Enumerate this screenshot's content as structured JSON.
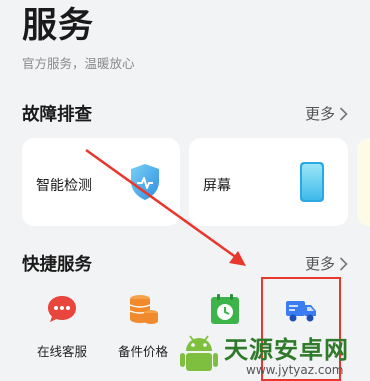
{
  "header": {
    "title": "服务",
    "subtitle": "官方服务，温暖放心"
  },
  "troubleshooting": {
    "title": "故障排查",
    "more_label": "更多",
    "cards": [
      {
        "label": "智能检测",
        "icon": "shield-check-icon"
      },
      {
        "label": "屏幕",
        "icon": "phone-screen-icon"
      }
    ]
  },
  "quick_services": {
    "title": "快捷服务",
    "more_label": "更多",
    "items": [
      {
        "label": "在线客服",
        "icon": "chat-bubble-icon",
        "color": "#e8453c"
      },
      {
        "label": "备件价格",
        "icon": "coins-stack-icon",
        "color": "#f08a2c"
      },
      {
        "label": "",
        "icon": "calendar-clock-icon",
        "color": "#3cb44a"
      },
      {
        "label": "",
        "icon": "truck-icon",
        "color": "#3b7cf0"
      }
    ]
  },
  "annotation": {
    "color": "#e8372c"
  },
  "watermark": {
    "brand": "天源安卓网",
    "url": "www.jytyaz.com"
  }
}
